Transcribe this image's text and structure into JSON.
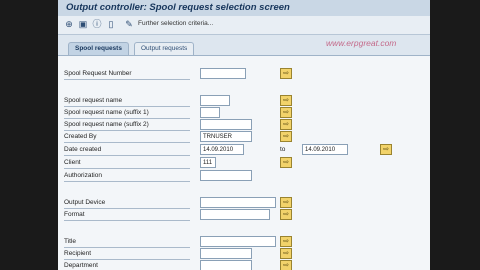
{
  "window": {
    "title": "Output controller: Spool request selection screen"
  },
  "toolbar": {
    "further_criteria_label": "Further selection criteria...",
    "icons": [
      "execute-icon",
      "variant-icon",
      "info-icon",
      "delete-icon"
    ]
  },
  "watermark": "www.erpgreat.com",
  "tabs": [
    {
      "label": "Spool requests",
      "active": true
    },
    {
      "label": "Output requests",
      "active": false
    }
  ],
  "form": {
    "spool_request_number": {
      "label": "Spool Request Number",
      "value": ""
    },
    "spool_request_name": {
      "label": "Spool request name",
      "value": ""
    },
    "suffix1": {
      "label": "Spool request name (suffix 1)",
      "value": ""
    },
    "suffix2": {
      "label": "Spool request name (suffix 2)",
      "value": ""
    },
    "created_by": {
      "label": "Created By",
      "value": "TRNUSER"
    },
    "date_created": {
      "label": "Date created",
      "from": "14.09.2010",
      "to_label": "to",
      "to": "14.09.2010"
    },
    "client": {
      "label": "Client",
      "value": "111"
    },
    "authorization": {
      "label": "Authorization",
      "value": ""
    },
    "output_device": {
      "label": "Output Device",
      "value": ""
    },
    "format": {
      "label": "Format",
      "value": ""
    },
    "title": {
      "label": "Title",
      "value": ""
    },
    "recipient": {
      "label": "Recipient",
      "value": ""
    },
    "department": {
      "label": "Department",
      "value": ""
    }
  },
  "colors": {
    "multi_select_button": "#f2d36a",
    "title_text": "#17365c"
  }
}
